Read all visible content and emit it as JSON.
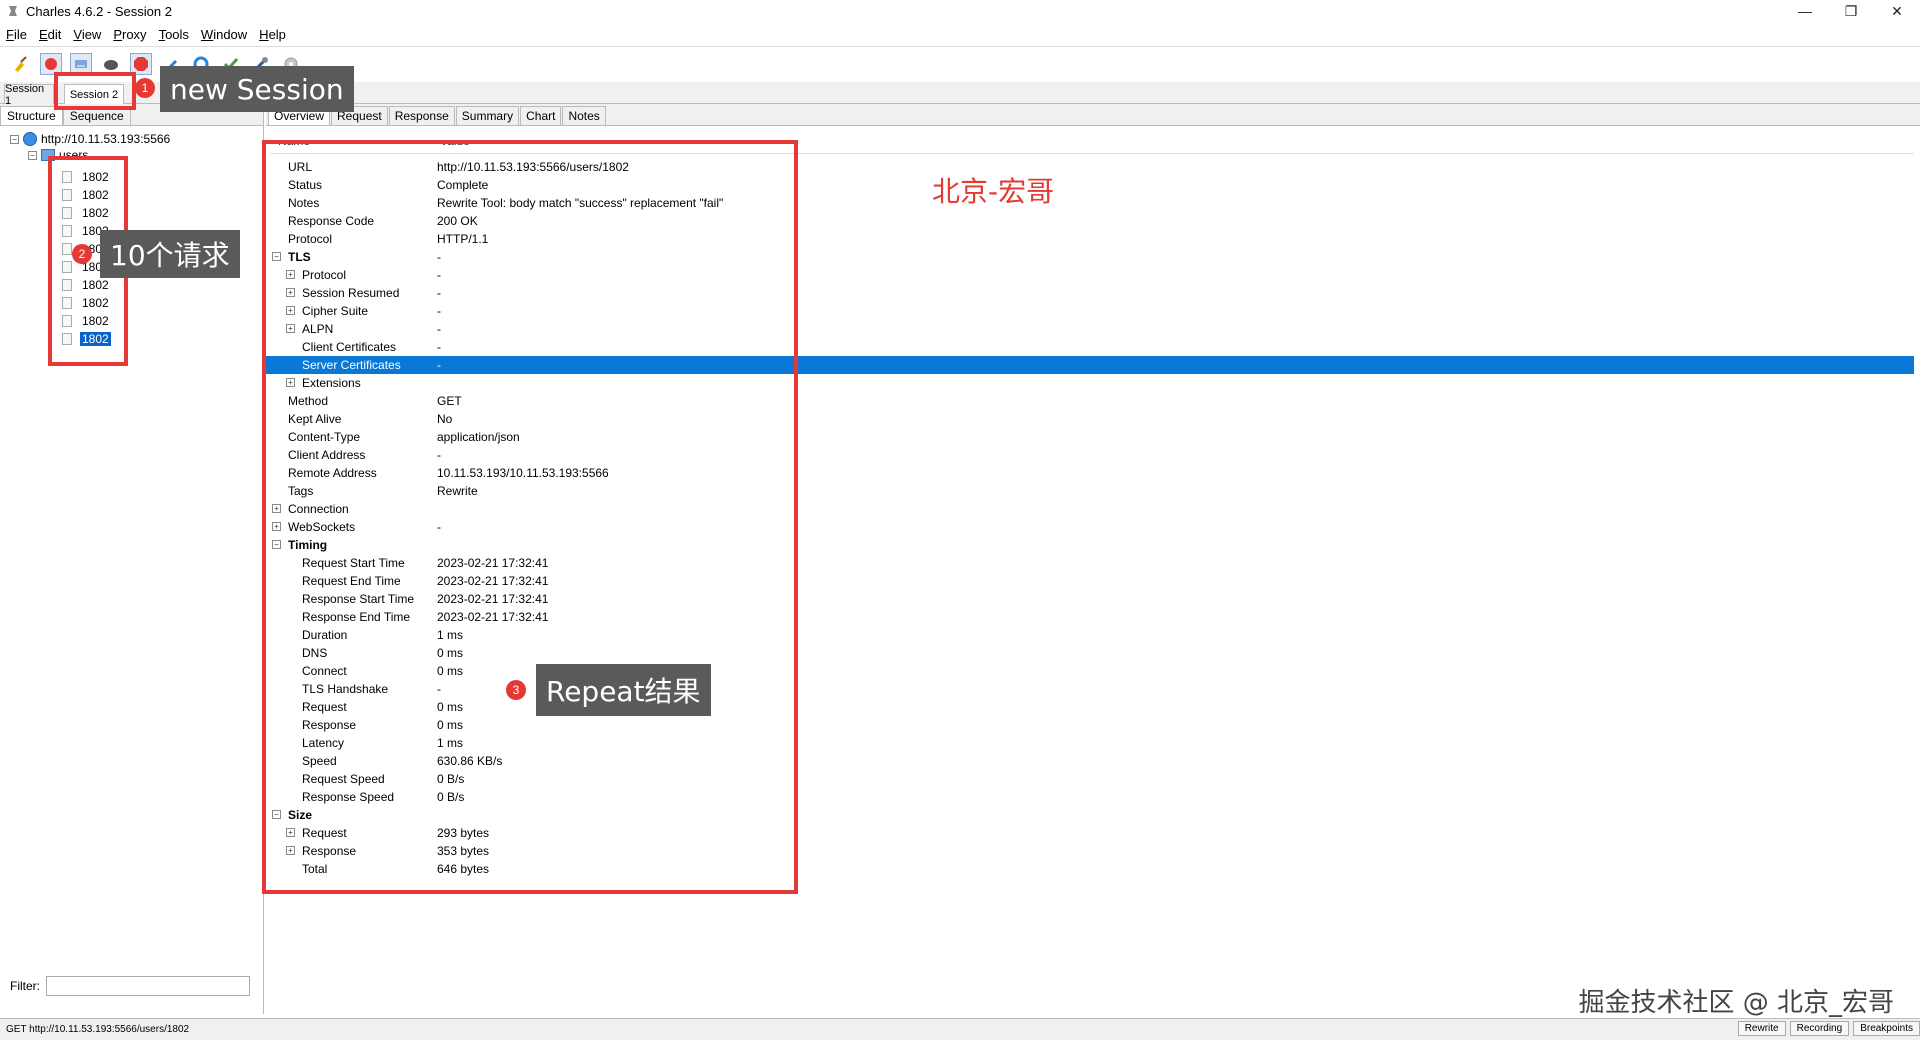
{
  "window": {
    "title": "Charles 4.6.2 - Session 2",
    "controls": [
      "—",
      "❐",
      "✕"
    ]
  },
  "menu": [
    "File",
    "Edit",
    "View",
    "Proxy",
    "Tools",
    "Window",
    "Help"
  ],
  "toolbar": {
    "icons": [
      "broom-icon",
      "record-icon",
      "throttle-icon",
      "breakpoint-icon",
      "stop-icon",
      "pen-icon",
      "repeat-icon",
      "validate-icon",
      "tools-icon",
      "settings-icon"
    ]
  },
  "sessions": {
    "tabs": [
      "Session 1",
      "Session 2"
    ],
    "active": "Session 2"
  },
  "left": {
    "tabs": [
      "Structure",
      "Sequence"
    ],
    "host": "http://10.11.53.193:5566",
    "folder": "users",
    "requests": [
      "1802",
      "1802",
      "1802",
      "1802",
      "1802",
      "1802",
      "1802",
      "1802",
      "1802",
      "1802"
    ],
    "selected_index": 9,
    "filter_label": "Filter:"
  },
  "right": {
    "tabs": [
      "Overview",
      "Request",
      "Response",
      "Summary",
      "Chart",
      "Notes"
    ],
    "active": "Overview",
    "columns": [
      "Name",
      "Value"
    ],
    "rows": [
      {
        "name": "URL",
        "value": "http://10.11.53.193:5566/users/1802",
        "level": 0,
        "toggle": ""
      },
      {
        "name": "Status",
        "value": "Complete",
        "level": 0,
        "toggle": ""
      },
      {
        "name": "Notes",
        "value": "Rewrite Tool: body match \"success\" replacement \"fail\"",
        "level": 0,
        "toggle": ""
      },
      {
        "name": "Response Code",
        "value": "200 OK",
        "level": 0,
        "toggle": ""
      },
      {
        "name": "Protocol",
        "value": "HTTP/1.1",
        "level": 0,
        "toggle": ""
      },
      {
        "name": "TLS",
        "value": "-",
        "level": 0,
        "toggle": "-",
        "bold": true
      },
      {
        "name": "Protocol",
        "value": "-",
        "level": 1,
        "toggle": "+"
      },
      {
        "name": "Session Resumed",
        "value": "-",
        "level": 1,
        "toggle": "+"
      },
      {
        "name": "Cipher Suite",
        "value": "-",
        "level": 1,
        "toggle": "+"
      },
      {
        "name": "ALPN",
        "value": "-",
        "level": 1,
        "toggle": "+"
      },
      {
        "name": "Client Certificates",
        "value": "-",
        "level": 1,
        "toggle": ""
      },
      {
        "name": "Server Certificates",
        "value": "-",
        "level": 1,
        "toggle": "",
        "selected": true
      },
      {
        "name": "Extensions",
        "value": "",
        "level": 1,
        "toggle": "+"
      },
      {
        "name": "Method",
        "value": "GET",
        "level": 0,
        "toggle": ""
      },
      {
        "name": "Kept Alive",
        "value": "No",
        "level": 0,
        "toggle": ""
      },
      {
        "name": "Content-Type",
        "value": "application/json",
        "level": 0,
        "toggle": ""
      },
      {
        "name": "Client Address",
        "value": "-",
        "level": 0,
        "toggle": ""
      },
      {
        "name": "Remote Address",
        "value": "10.11.53.193/10.11.53.193:5566",
        "level": 0,
        "toggle": ""
      },
      {
        "name": "Tags",
        "value": "Rewrite",
        "level": 0,
        "toggle": ""
      },
      {
        "name": "Connection",
        "value": "",
        "level": 0,
        "toggle": "+"
      },
      {
        "name": "WebSockets",
        "value": "-",
        "level": 0,
        "toggle": "+"
      },
      {
        "name": "Timing",
        "value": "",
        "level": 0,
        "toggle": "-",
        "bold": true
      },
      {
        "name": "Request Start Time",
        "value": "2023-02-21 17:32:41",
        "level": 1,
        "toggle": ""
      },
      {
        "name": "Request End Time",
        "value": "2023-02-21 17:32:41",
        "level": 1,
        "toggle": ""
      },
      {
        "name": "Response Start Time",
        "value": "2023-02-21 17:32:41",
        "level": 1,
        "toggle": ""
      },
      {
        "name": "Response End Time",
        "value": "2023-02-21 17:32:41",
        "level": 1,
        "toggle": ""
      },
      {
        "name": "Duration",
        "value": "1 ms",
        "level": 1,
        "toggle": ""
      },
      {
        "name": "DNS",
        "value": "0 ms",
        "level": 1,
        "toggle": ""
      },
      {
        "name": "Connect",
        "value": "0 ms",
        "level": 1,
        "toggle": ""
      },
      {
        "name": "TLS Handshake",
        "value": "-",
        "level": 1,
        "toggle": ""
      },
      {
        "name": "Request",
        "value": "0 ms",
        "level": 1,
        "toggle": ""
      },
      {
        "name": "Response",
        "value": "0 ms",
        "level": 1,
        "toggle": ""
      },
      {
        "name": "Latency",
        "value": "1 ms",
        "level": 1,
        "toggle": ""
      },
      {
        "name": "Speed",
        "value": "630.86 KB/s",
        "level": 1,
        "toggle": ""
      },
      {
        "name": "Request Speed",
        "value": "0 B/s",
        "level": 1,
        "toggle": ""
      },
      {
        "name": "Response Speed",
        "value": "0 B/s",
        "level": 1,
        "toggle": ""
      },
      {
        "name": "Size",
        "value": "",
        "level": 0,
        "toggle": "-",
        "bold": true
      },
      {
        "name": "Request",
        "value": "293 bytes",
        "level": 1,
        "toggle": "+"
      },
      {
        "name": "Response",
        "value": "353 bytes",
        "level": 1,
        "toggle": "+"
      },
      {
        "name": "Total",
        "value": "646 bytes",
        "level": 1,
        "toggle": ""
      }
    ]
  },
  "annotations": {
    "callout1": {
      "badge": "1",
      "text": "new Session"
    },
    "callout2": {
      "badge": "2",
      "text": "10个请求"
    },
    "callout3": {
      "badge": "3",
      "text": "Repeat结果"
    },
    "red_label": "北京-宏哥",
    "bottom_watermark": "掘金技术社区 @ 北京_宏哥"
  },
  "status": {
    "text": "GET http://10.11.53.193:5566/users/1802",
    "buttons": [
      "Rewrite",
      "Recording",
      "Breakpoints"
    ]
  },
  "colors": {
    "annotation_red": "#e53935",
    "selection_blue": "#0a78d6",
    "callout_gray": "#5a5a5a"
  }
}
